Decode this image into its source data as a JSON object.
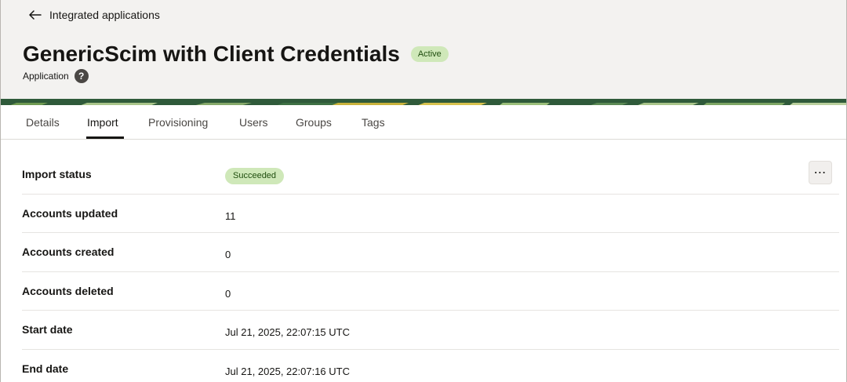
{
  "header": {
    "back_label": "Integrated applications",
    "title": "GenericScim with Client Credentials",
    "status_badge": "Active",
    "subtitle": "Application",
    "help_glyph": "?"
  },
  "tabs": [
    {
      "label": "Details",
      "active": false
    },
    {
      "label": "Import",
      "active": true
    },
    {
      "label": "Provisioning",
      "active": false
    },
    {
      "label": "Users",
      "active": false
    },
    {
      "label": "Groups",
      "active": false
    },
    {
      "label": "Tags",
      "active": false
    }
  ],
  "import": {
    "rows": [
      {
        "label": "Import status",
        "value": "Succeeded"
      },
      {
        "label": "Accounts updated",
        "value": "11"
      },
      {
        "label": "Accounts created",
        "value": "0"
      },
      {
        "label": "Accounts deleted",
        "value": "0"
      },
      {
        "label": "Start date",
        "value": "Jul 21, 2025, 22:07:15 UTC"
      },
      {
        "label": "End date",
        "value": "Jul 21, 2025, 22:07:16 UTC"
      }
    ],
    "more_glyph": "⋯"
  },
  "colors": {
    "success_badge_bg": "#cfe8b9",
    "header_bg": "#f3f2f0",
    "banner_green": "#2f5a3a",
    "banner_yellow": "#c9b23c"
  },
  "icons": [
    "back-arrow-icon",
    "help-icon",
    "more-actions-icon"
  ]
}
